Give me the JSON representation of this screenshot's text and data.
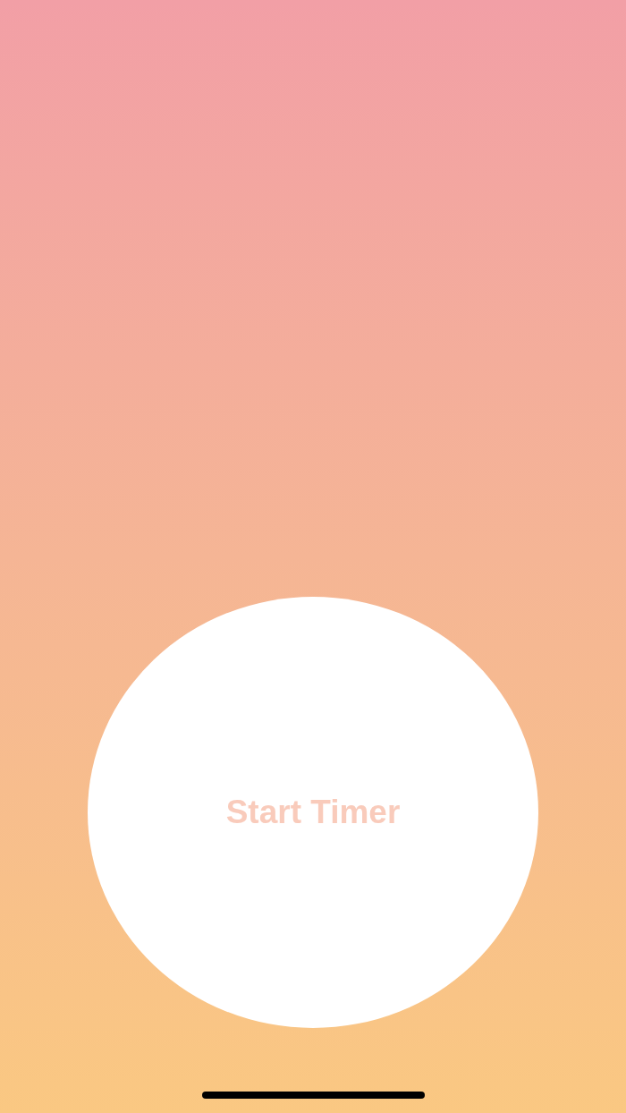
{
  "timer_button": {
    "label": "Start Timer"
  }
}
